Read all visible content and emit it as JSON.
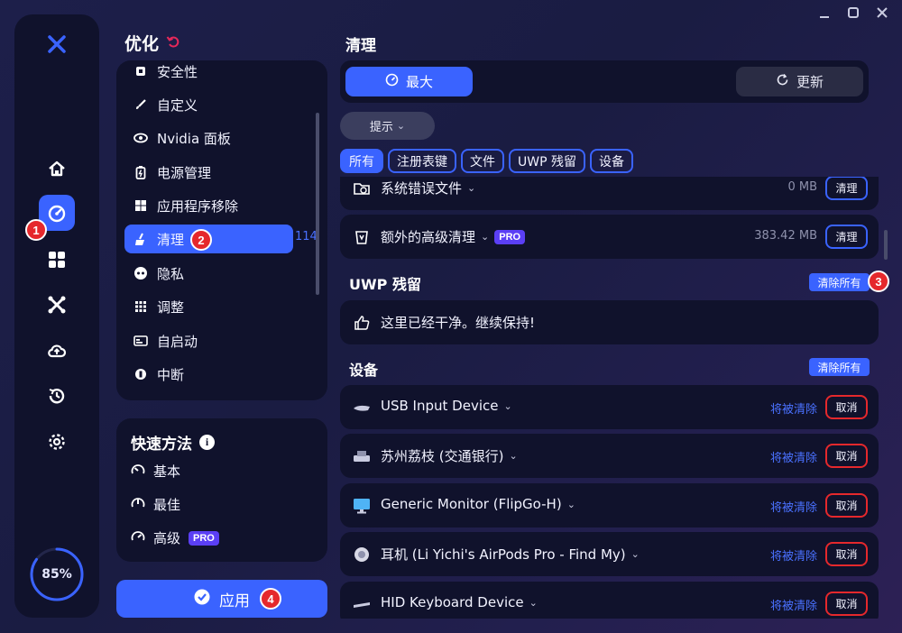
{
  "window": {
    "controls": [
      "minimize",
      "maximize",
      "close"
    ]
  },
  "rail": {
    "gauge_value": 0.85,
    "gauge_text": "85%",
    "items": [
      "home-icon",
      "dashboard-icon",
      "apps-icon",
      "tools-icon",
      "cloud-upload-icon",
      "history-icon",
      "settings-icon"
    ],
    "active": "dashboard-icon"
  },
  "markers": [
    "1",
    "2",
    "3",
    "4"
  ],
  "optimize": {
    "title": "优化",
    "menu": [
      {
        "label": "安全性",
        "icon": "shield-icon"
      },
      {
        "label": "自定义",
        "icon": "brush-icon"
      },
      {
        "label": "Nvidia 面板",
        "icon": "nvidia-icon"
      },
      {
        "label": "电源管理",
        "icon": "battery-icon"
      },
      {
        "label": "应用程序移除",
        "icon": "windows-icon"
      },
      {
        "label": "清理",
        "icon": "broom-icon",
        "active": true,
        "count": "114"
      },
      {
        "label": "隐私",
        "icon": "privacy-icon"
      },
      {
        "label": "调整",
        "icon": "grid-icon"
      },
      {
        "label": "自启动",
        "icon": "startup-icon"
      },
      {
        "label": "中断",
        "icon": "interrupt-icon"
      }
    ]
  },
  "quick": {
    "title": "快速方法",
    "items": [
      {
        "label": "基本",
        "icon": "speed-low-icon"
      },
      {
        "label": "最佳",
        "icon": "speed-mid-icon"
      },
      {
        "label": "高级",
        "icon": "speed-high-icon",
        "badge": "PRO"
      }
    ]
  },
  "apply_label": "应用",
  "cleanup": {
    "title": "清理",
    "max_label": "最大",
    "update_label": "更新",
    "tip_label": "提示",
    "filters": [
      "所有",
      "注册表键",
      "文件",
      "UWP 残留",
      "设备"
    ],
    "active_filter": "所有",
    "files": [
      {
        "label": "系统错误文件",
        "size": "0 MB",
        "action": "清理"
      },
      {
        "label": "额外的高级清理",
        "size": "383.42 MB",
        "action": "清理",
        "badge": "PRO"
      }
    ],
    "uwp": {
      "title": "UWP 残留",
      "clear_all": "清除所有",
      "empty_message": "这里已经干净。继续保持!"
    },
    "devices": {
      "title": "设备",
      "clear_all": "清除所有",
      "status": "将被清除",
      "cancel": "取消",
      "items": [
        "USB Input Device",
        "苏州荔枝 (交通银行)",
        "Generic Monitor (FlipGo-H)",
        "耳机 (Li Yichi's AirPods Pro - Find My)",
        "HID Keyboard Device"
      ]
    }
  }
}
